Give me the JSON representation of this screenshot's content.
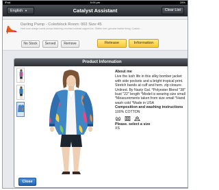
{
  "statusbar": {
    "carrier": "iPad",
    "time": "5:05 pm",
    "battery": "28%"
  },
  "navbar": {
    "language_button": "English",
    "title": "Catalyst Assistant",
    "clear_button": "Clear List"
  },
  "product": {
    "title": "Darling Pump - Colorblock Room: 002 Size:45",
    "description": "Heel-tone orange suede pumps featuring a fuchsia contrast capped toe. Stiletto heel, genuine leather lining. Custom...",
    "actions": {
      "no_stock": "No Stock",
      "served": "Served",
      "remove": "Remove",
      "release": "Release",
      "information": "Information"
    }
  },
  "modal": {
    "title": "Product Information",
    "about_heading": "About me",
    "about_text": "Live the lush life in this silky bomber jacket with side pockets and a bright tropical print. Stretch bands at cuff and hem. zip closure. Unlined. By Nasty Gal. *Polyester Blend \"38\" bust \"22\" length *Model is wearing size small *Measurements taken from size small *Hand wash cold *Made in USA",
    "composition_heading": "Composition and washing instructions",
    "composition_text": "100% COTTON",
    "care_icons": [
      "do-not-wash-icon",
      "do-not-tumble-dry-icon",
      "do-not-bleach-icon"
    ],
    "size_heading": "Please. select a size",
    "size_value": "XS",
    "close_button": "Close"
  },
  "colors": {
    "navbar": "#2c2f33",
    "release_button": "#f4c837",
    "close_button": "#1f63b4"
  }
}
